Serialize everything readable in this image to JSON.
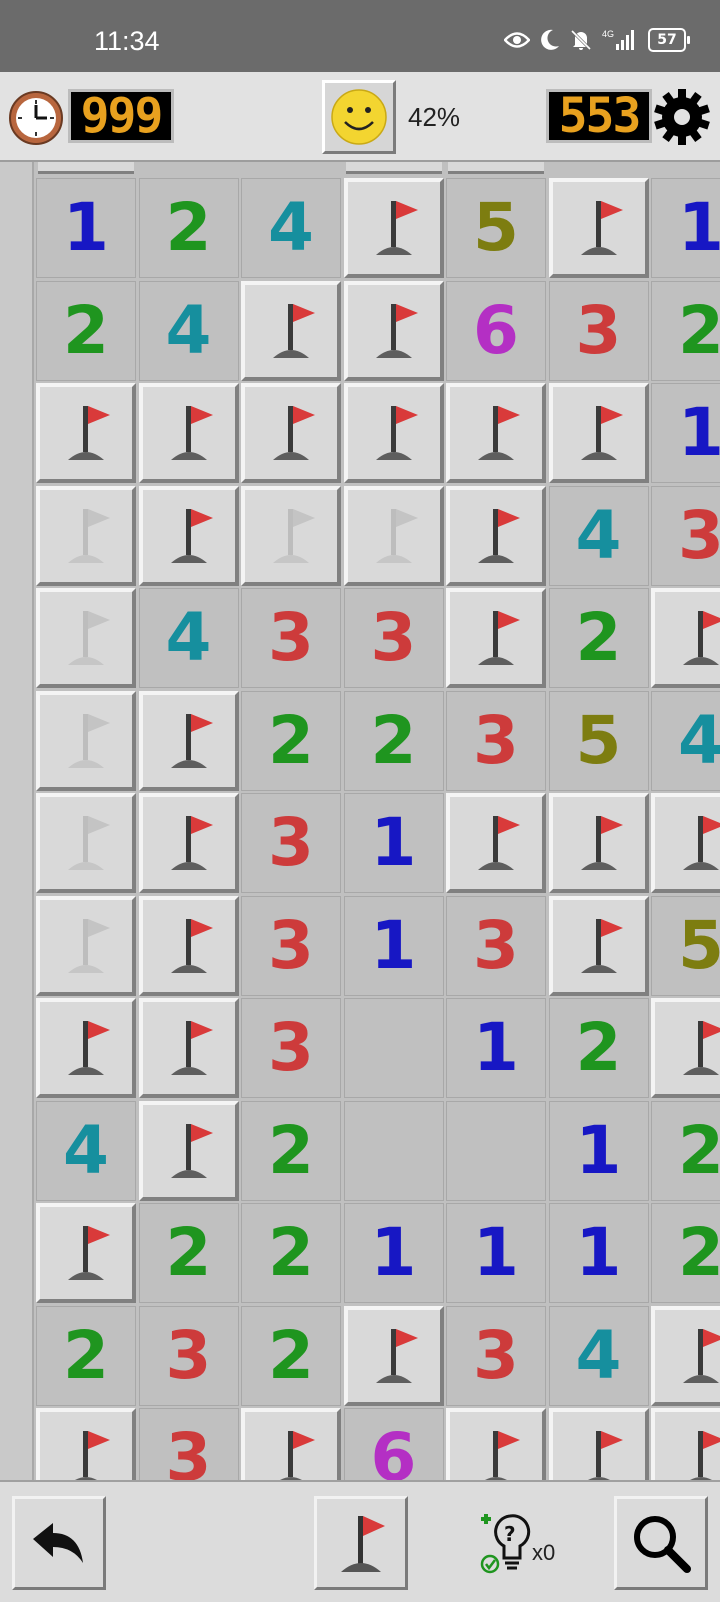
{
  "status_bar": {
    "time": "11:34",
    "network": "4G",
    "battery": "57"
  },
  "top_bar": {
    "timer_value": "999",
    "progress": "42%",
    "mines_remaining": "553",
    "face": "smiley"
  },
  "colors": {
    "1": "#1717c4",
    "2": "#1f951f",
    "3": "#cd3b3b",
    "4": "#168f9e",
    "5": "#7d7d10",
    "6": "#b42fc4",
    "counter_digits": "#e8a11f",
    "flag": "#d93a3a"
  },
  "board": {
    "legend": "F = flag, f = faded flag, . = empty revealed cell, digits = revealed number",
    "rows": [
      [
        "1",
        "2",
        "4",
        "F",
        "5",
        "F",
        "1"
      ],
      [
        "2",
        "4",
        "F",
        "F",
        "6",
        "3",
        "2"
      ],
      [
        "F",
        "F",
        "F",
        "F",
        "F",
        "F",
        "1"
      ],
      [
        "f",
        "F",
        "f",
        "f",
        "F",
        "4",
        "3"
      ],
      [
        "f",
        "4",
        "3",
        "3",
        "F",
        "2",
        "F"
      ],
      [
        "f",
        "F",
        "2",
        "2",
        "3",
        "5",
        "4"
      ],
      [
        "f",
        "F",
        "3",
        "1",
        "F",
        "F",
        "F"
      ],
      [
        "f",
        "F",
        "3",
        "1",
        "3",
        "F",
        "5"
      ],
      [
        "F",
        "F",
        "3",
        ".",
        "1",
        "2",
        "F"
      ],
      [
        "4",
        "F",
        "2",
        ".",
        ".",
        "1",
        "2"
      ],
      [
        "F",
        "2",
        "2",
        "1",
        "1",
        "1",
        "2"
      ],
      [
        "2",
        "3",
        "2",
        "F",
        "3",
        "4",
        "F"
      ],
      [
        "F",
        "3",
        "F",
        "6",
        "F",
        "F",
        "F"
      ]
    ],
    "top_stub_columns": [
      0,
      3,
      4
    ]
  },
  "bottom_bar": {
    "undo": "undo-arrow",
    "flag_mode": "flag",
    "hint_count": "x0",
    "search": "magnifier"
  }
}
